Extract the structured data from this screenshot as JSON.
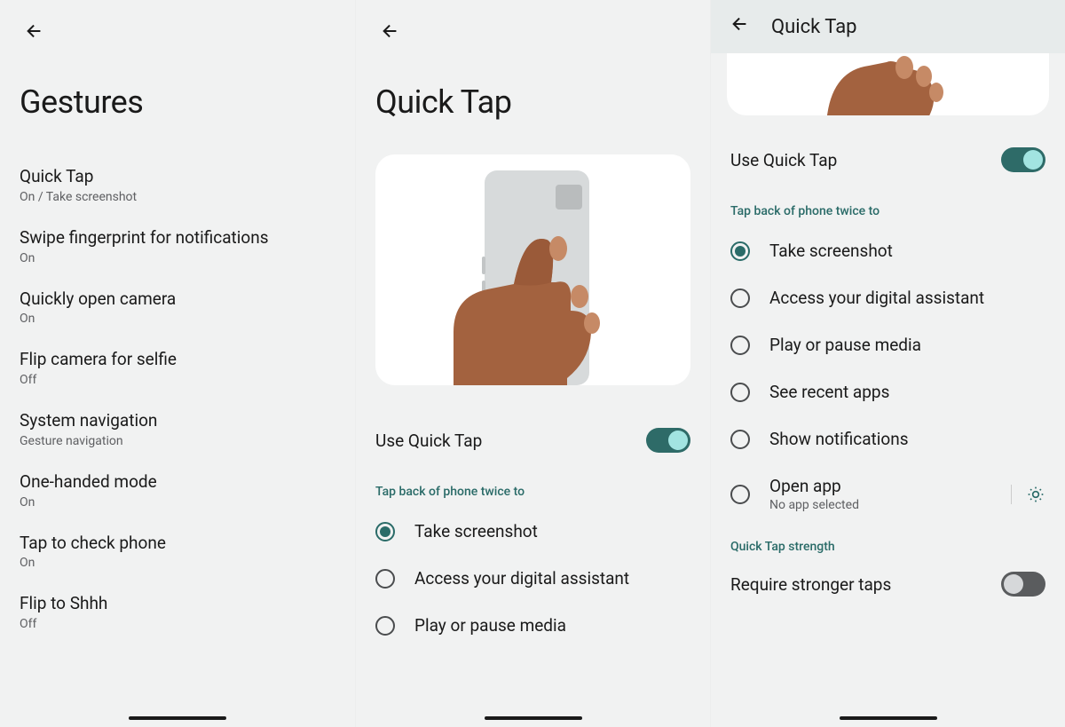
{
  "panel1": {
    "title": "Gestures",
    "items": [
      {
        "title": "Quick Tap",
        "sub": "On / Take screenshot"
      },
      {
        "title": "Swipe fingerprint for notifications",
        "sub": "On"
      },
      {
        "title": "Quickly open camera",
        "sub": "On"
      },
      {
        "title": "Flip camera for selfie",
        "sub": "Off"
      },
      {
        "title": "System navigation",
        "sub": "Gesture navigation"
      },
      {
        "title": "One-handed mode",
        "sub": "On"
      },
      {
        "title": "Tap to check phone",
        "sub": "On"
      },
      {
        "title": "Flip to Shhh",
        "sub": "Off"
      }
    ]
  },
  "panel2": {
    "title": "Quick Tap",
    "toggle_label": "Use Quick Tap",
    "section": "Tap back of phone twice to",
    "options": [
      {
        "title": "Take screenshot",
        "selected": true
      },
      {
        "title": "Access your digital assistant",
        "selected": false
      },
      {
        "title": "Play or pause media",
        "selected": false
      }
    ]
  },
  "panel3": {
    "header_title": "Quick Tap",
    "toggle_label": "Use Quick Tap",
    "section": "Tap back of phone twice to",
    "options": [
      {
        "title": "Take screenshot",
        "selected": true
      },
      {
        "title": "Access your digital assistant",
        "selected": false
      },
      {
        "title": "Play or pause media",
        "selected": false
      },
      {
        "title": "See recent apps",
        "selected": false
      },
      {
        "title": "Show notifications",
        "selected": false
      },
      {
        "title": "Open app",
        "sub": "No app selected",
        "selected": false,
        "gear": true
      }
    ],
    "section2": "Quick Tap strength",
    "strength_label": "Require stronger taps"
  }
}
